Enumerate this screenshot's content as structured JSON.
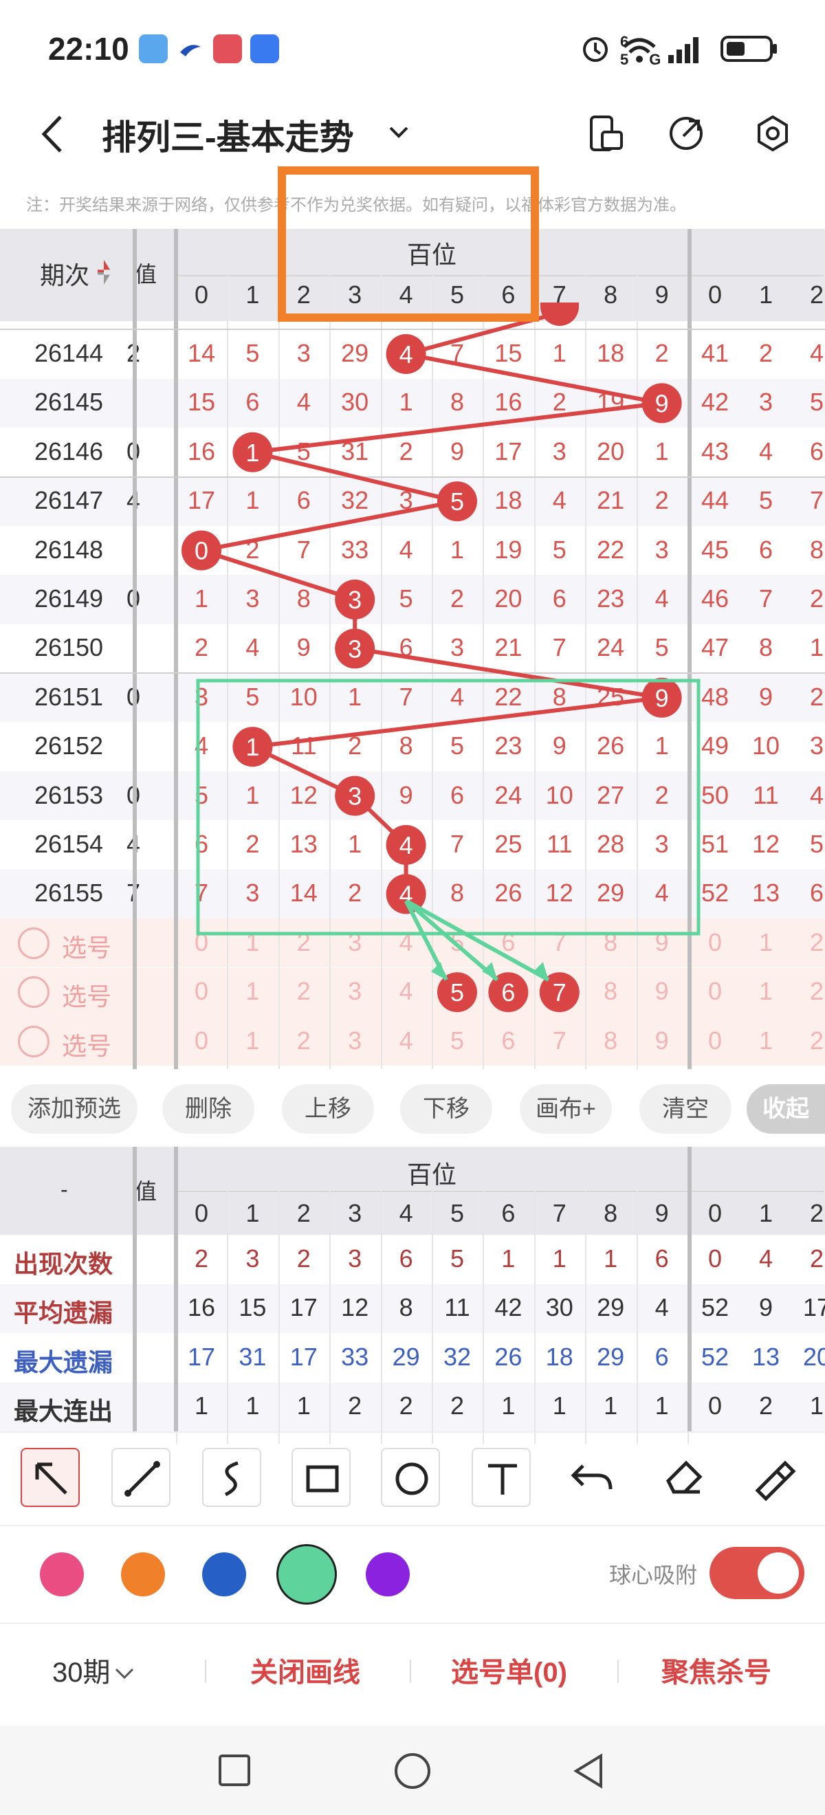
{
  "status": {
    "time": "22:10",
    "net": "6 5G"
  },
  "title": {
    "text": "排列三-基本走势"
  },
  "notice": "注：开奖结果来源于网络，仅供参考不作为兑奖依据。如有疑问，以福体彩官方数据为准。",
  "table": {
    "period_header": "期次",
    "value_header": "值",
    "group_header": "百位",
    "digits": [
      "0",
      "1",
      "2",
      "3",
      "4",
      "5",
      "6",
      "7",
      "8",
      "9"
    ],
    "right_digits": [
      "0",
      "1",
      "2"
    ],
    "rows": [
      {
        "period": "26144",
        "c0": "2",
        "vals": [
          "14",
          "5",
          "3",
          "29",
          "4",
          "7",
          "15",
          "1",
          "18",
          "2"
        ],
        "ball": 4,
        "right": [
          "41",
          "2",
          "4"
        ]
      },
      {
        "period": "26145",
        "c0": "",
        "vals": [
          "15",
          "6",
          "4",
          "30",
          "1",
          "8",
          "16",
          "2",
          "19",
          "9"
        ],
        "ball": 9,
        "right": [
          "42",
          "3",
          "5"
        ]
      },
      {
        "period": "26146",
        "c0": "0",
        "vals": [
          "16",
          "1",
          "5",
          "31",
          "2",
          "9",
          "17",
          "3",
          "20",
          "1"
        ],
        "ball": 1,
        "right": [
          "43",
          "4",
          "6"
        ]
      },
      {
        "period": "26147",
        "c0": "4",
        "vals": [
          "17",
          "1",
          "6",
          "32",
          "3",
          "5",
          "18",
          "4",
          "21",
          "2"
        ],
        "ball": 5,
        "right": [
          "44",
          "5",
          "7"
        ]
      },
      {
        "period": "26148",
        "c0": "",
        "vals": [
          "0",
          "2",
          "7",
          "33",
          "4",
          "1",
          "19",
          "5",
          "22",
          "3"
        ],
        "ball": 0,
        "right": [
          "45",
          "6",
          "8"
        ]
      },
      {
        "period": "26149",
        "c0": "0",
        "vals": [
          "1",
          "3",
          "8",
          "3",
          "5",
          "2",
          "20",
          "6",
          "23",
          "4"
        ],
        "ball": 3,
        "right": [
          "46",
          "7",
          "2"
        ]
      },
      {
        "period": "26150",
        "c0": "",
        "vals": [
          "2",
          "4",
          "9",
          "3",
          "6",
          "3",
          "21",
          "7",
          "24",
          "5"
        ],
        "ball": 3,
        "right": [
          "47",
          "8",
          "1"
        ]
      },
      {
        "period": "26151",
        "c0": "0",
        "vals": [
          "3",
          "5",
          "10",
          "1",
          "7",
          "4",
          "22",
          "8",
          "25",
          "9"
        ],
        "ball": 9,
        "right": [
          "48",
          "9",
          "2"
        ]
      },
      {
        "period": "26152",
        "c0": "",
        "vals": [
          "4",
          "1",
          "11",
          "2",
          "8",
          "5",
          "23",
          "9",
          "26",
          "1"
        ],
        "ball": 1,
        "right": [
          "49",
          "10",
          "3"
        ]
      },
      {
        "period": "26153",
        "c0": "0",
        "vals": [
          "5",
          "1",
          "12",
          "3",
          "9",
          "6",
          "24",
          "10",
          "27",
          "2"
        ],
        "ball": 3,
        "right": [
          "50",
          "11",
          "4"
        ]
      },
      {
        "period": "26154",
        "c0": "4",
        "vals": [
          "6",
          "2",
          "13",
          "1",
          "4",
          "7",
          "25",
          "11",
          "28",
          "3"
        ],
        "ball": 4,
        "right": [
          "51",
          "12",
          "5"
        ]
      },
      {
        "period": "26155",
        "c0": "7",
        "vals": [
          "7",
          "3",
          "14",
          "2",
          "4",
          "8",
          "26",
          "12",
          "29",
          "4"
        ],
        "ball": 4,
        "right": [
          "52",
          "13",
          "6"
        ]
      }
    ],
    "select_label": "选号"
  },
  "actions": [
    "添加预选",
    "删除",
    "上移",
    "下移",
    "画布+",
    "清空",
    "收起"
  ],
  "stats": {
    "dash": "-",
    "value_header": "值",
    "group_header": "百位",
    "rows": [
      {
        "label": "出现次数",
        "color": "#b23b3b",
        "vals": [
          "2",
          "3",
          "2",
          "3",
          "6",
          "5",
          "1",
          "1",
          "1",
          "6"
        ],
        "right": [
          "0",
          "4",
          "2"
        ]
      },
      {
        "label": "平均遗漏",
        "color": "#b23b3b",
        "vals": [
          "16",
          "15",
          "17",
          "12",
          "8",
          "11",
          "42",
          "30",
          "29",
          "4"
        ],
        "right": [
          "52",
          "9",
          "17"
        ]
      },
      {
        "label": "最大遗漏",
        "color": "#3d5fbf",
        "vals": [
          "17",
          "31",
          "17",
          "33",
          "29",
          "32",
          "26",
          "18",
          "29",
          "6"
        ],
        "right": [
          "52",
          "13",
          "20"
        ]
      },
      {
        "label": "最大连出",
        "color": "#333",
        "vals": [
          "1",
          "1",
          "1",
          "2",
          "2",
          "2",
          "1",
          "1",
          "1",
          "1"
        ],
        "right": [
          "0",
          "2",
          "1"
        ]
      }
    ]
  },
  "colors": {
    "pink": "#ea4d82",
    "orange": "#f0812a",
    "blue": "#2660c6",
    "green": "#5fd39c",
    "purple": "#8a22e0",
    "accent": "#e0504a"
  },
  "snap_label": "球心吸附",
  "bottom": {
    "periods": "30期",
    "close": "关闭画线",
    "list": "选号单(0)",
    "focus": "聚焦杀号"
  }
}
